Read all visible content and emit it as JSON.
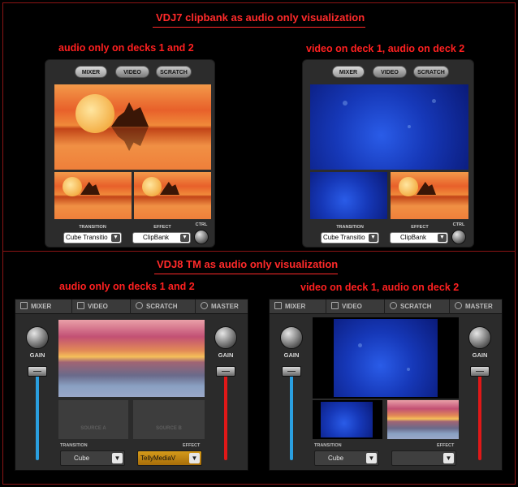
{
  "section1": {
    "title": "VDJ7 clipbank as audio only visualization",
    "left_caption": "audio only on decks 1 and 2",
    "right_caption": "video on deck 1, audio on deck 2"
  },
  "section2": {
    "title": "VDJ8 TM as audio only visualization",
    "left_caption": "audio only on decks 1 and 2",
    "right_caption": "video on deck 1, audio on deck 2"
  },
  "vdj7": {
    "tabs": [
      "MIXER",
      "VIDEO",
      "SCRATCH"
    ],
    "transition_label": "TRANSITION",
    "effect_label": "EFFECT",
    "ctrl_label": "CTRL",
    "transition_value": "Cube Transitio",
    "effect_value": "ClipBank",
    "arrow": "▼"
  },
  "vdj8": {
    "tabs": [
      "MIXER",
      "VIDEO",
      "SCRATCH",
      "MASTER"
    ],
    "gain_label": "GAIN",
    "transition_label": "TRANSITION",
    "effect_label": "EFFECT",
    "transition_value": "Cube",
    "source_a": "SOURCE A",
    "source_b": "SOURCE B",
    "effect_value_left": "TellyMediaV",
    "effect_value_right": "",
    "arrow": "▼"
  },
  "colors": {
    "accent_red": "#ff2a2a",
    "fader_left": "#2a9fe0",
    "fader_right": "#e01818",
    "effect_highlight": "#d49a1a"
  }
}
